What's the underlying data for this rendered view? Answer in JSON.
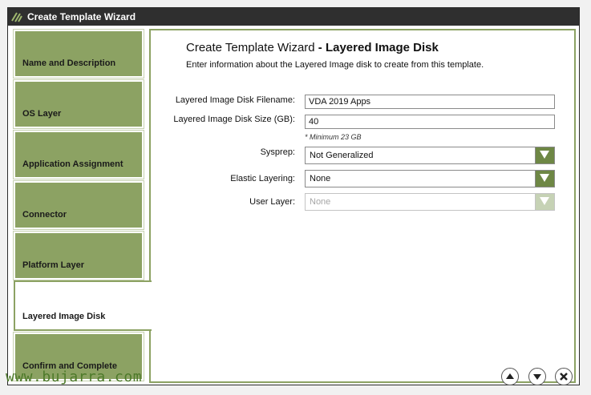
{
  "window": {
    "title": "Create Template Wizard"
  },
  "steps": [
    {
      "label": "Name and Description"
    },
    {
      "label": "OS Layer"
    },
    {
      "label": "Application Assignment"
    },
    {
      "label": "Connector"
    },
    {
      "label": "Platform Layer"
    },
    {
      "label": "Layered Image Disk"
    },
    {
      "label": "Confirm and Complete"
    }
  ],
  "main": {
    "heading_prefix": "Create Template Wizard",
    "heading_suffix": "- Layered Image Disk",
    "subtitle": "Enter information about the Layered Image disk to create from this template.",
    "filename_label": "Layered Image Disk Filename:",
    "filename_value": "VDA 2019 Apps",
    "size_label": "Layered Image Disk Size (GB):",
    "size_value": "40",
    "size_hint": "* Minimum 23 GB",
    "sysprep_label": "Sysprep:",
    "sysprep_value": "Not Generalized",
    "elastic_label": "Elastic Layering:",
    "elastic_value": "None",
    "userlayer_label": "User Layer:",
    "userlayer_value": "None"
  },
  "watermark": "www.bujarra.com",
  "colors": {
    "accent": "#8ca263",
    "titlebar": "#2f2f2f",
    "arrow": "#6e8745"
  }
}
